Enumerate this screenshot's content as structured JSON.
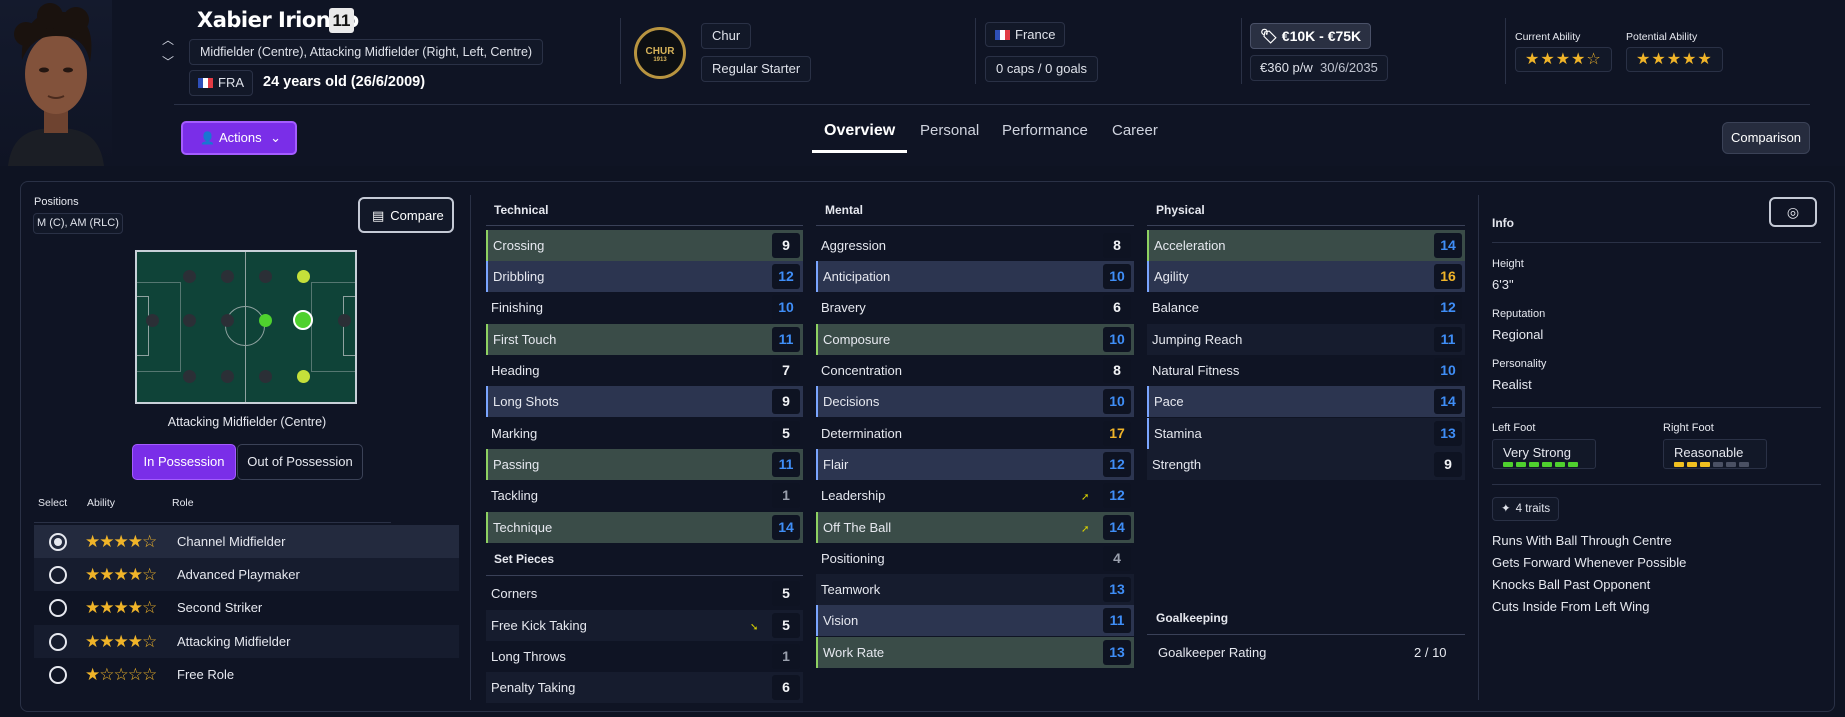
{
  "player": {
    "name": "Xabier Iriondo",
    "number": "11",
    "positions_long": "Midfielder (Centre), Attacking Midfielder (Right, Left, Centre)",
    "nationality_code": "FRA",
    "age_line": "24 years old (26/6/2009)"
  },
  "club": {
    "name": "Chur",
    "badge_text": "CHUR",
    "badge_year": "1913",
    "squad_status": "Regular Starter"
  },
  "nation": {
    "name": "France",
    "caps": "0 caps / 0 goals"
  },
  "contract": {
    "value_range": "€10K - €75K",
    "wage": "€360 p/w",
    "expires": "30/6/2035"
  },
  "ability": {
    "current_label": "Current Ability",
    "potential_label": "Potential Ability",
    "current_stars": "★★★★☆",
    "potential_stars": "★★★★★"
  },
  "nav": {
    "actions": "Actions",
    "tabs": [
      "Overview",
      "Personal",
      "Performance",
      "Career"
    ],
    "comparison": "Comparison"
  },
  "positions": {
    "title": "Positions",
    "short": "M (C), AM (RLC)",
    "compare": "Compare",
    "selected": "Attacking Midfielder (Centre)",
    "in_possession": "In Possession",
    "out_possession": "Out of Possession"
  },
  "roles": {
    "headers": [
      "Select",
      "Ability",
      "Role"
    ],
    "items": [
      {
        "name": "Channel Midfielder",
        "stars": "★★★★☆"
      },
      {
        "name": "Advanced Playmaker",
        "stars": "★★★★☆"
      },
      {
        "name": "Second Striker",
        "stars": "★★★★☆"
      },
      {
        "name": "Attacking Midfielder",
        "stars": "★★★★☆"
      },
      {
        "name": "Free Role",
        "stars": "★☆☆☆☆"
      }
    ]
  },
  "technical": {
    "title": "Technical",
    "items": [
      {
        "name": "Crossing",
        "value": "9"
      },
      {
        "name": "Dribbling",
        "value": "12"
      },
      {
        "name": "Finishing",
        "value": "10"
      },
      {
        "name": "First Touch",
        "value": "11"
      },
      {
        "name": "Heading",
        "value": "7"
      },
      {
        "name": "Long Shots",
        "value": "9"
      },
      {
        "name": "Marking",
        "value": "5"
      },
      {
        "name": "Passing",
        "value": "11"
      },
      {
        "name": "Tackling",
        "value": "1"
      },
      {
        "name": "Technique",
        "value": "14"
      }
    ]
  },
  "set_pieces": {
    "title": "Set Pieces",
    "items": [
      {
        "name": "Corners",
        "value": "5"
      },
      {
        "name": "Free Kick Taking",
        "value": "5"
      },
      {
        "name": "Long Throws",
        "value": "1"
      },
      {
        "name": "Penalty Taking",
        "value": "6"
      }
    ]
  },
  "mental": {
    "title": "Mental",
    "items": [
      {
        "name": "Aggression",
        "value": "8"
      },
      {
        "name": "Anticipation",
        "value": "10"
      },
      {
        "name": "Bravery",
        "value": "6"
      },
      {
        "name": "Composure",
        "value": "10"
      },
      {
        "name": "Concentration",
        "value": "8"
      },
      {
        "name": "Decisions",
        "value": "10"
      },
      {
        "name": "Determination",
        "value": "17"
      },
      {
        "name": "Flair",
        "value": "12"
      },
      {
        "name": "Leadership",
        "value": "12"
      },
      {
        "name": "Off The Ball",
        "value": "14"
      },
      {
        "name": "Positioning",
        "value": "4"
      },
      {
        "name": "Teamwork",
        "value": "13"
      },
      {
        "name": "Vision",
        "value": "11"
      },
      {
        "name": "Work Rate",
        "value": "13"
      }
    ]
  },
  "physical": {
    "title": "Physical",
    "items": [
      {
        "name": "Acceleration",
        "value": "14"
      },
      {
        "name": "Agility",
        "value": "16"
      },
      {
        "name": "Balance",
        "value": "12"
      },
      {
        "name": "Jumping Reach",
        "value": "11"
      },
      {
        "name": "Natural Fitness",
        "value": "10"
      },
      {
        "name": "Pace",
        "value": "14"
      },
      {
        "name": "Stamina",
        "value": "13"
      },
      {
        "name": "Strength",
        "value": "9"
      }
    ]
  },
  "goalkeeping": {
    "title": "Goalkeeping",
    "label": "Goalkeeper Rating",
    "value": "2 / 10"
  },
  "info": {
    "title": "Info",
    "height_label": "Height",
    "height": "6'3\"",
    "reputation_label": "Reputation",
    "reputation": "Regional",
    "personality_label": "Personality",
    "personality": "Realist",
    "left_foot_label": "Left Foot",
    "left_foot": "Very Strong",
    "right_foot_label": "Right Foot",
    "right_foot": "Reasonable",
    "traits_count": "4 traits",
    "traits": [
      "Runs With Ball Through Centre",
      "Gets Forward Whenever Possible",
      "Knocks Ball Past Opponent",
      "Cuts Inside From Left Wing"
    ]
  },
  "colors": {
    "accent": "#7a2ee8",
    "attr_blue": "#3f8ef7",
    "attr_gold": "#f0b429",
    "key_green": "#8ed162"
  }
}
